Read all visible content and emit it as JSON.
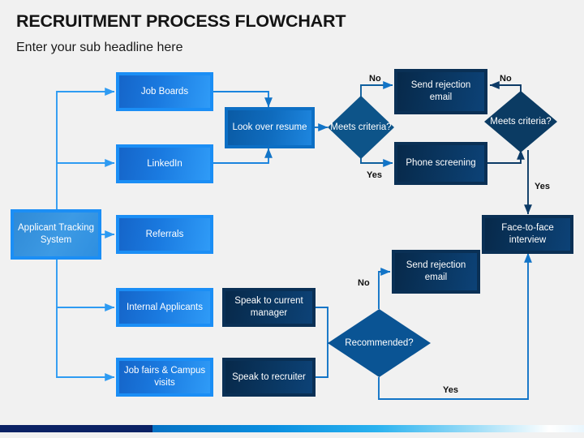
{
  "slide": {
    "title": "RECRUITMENT PROCESS FLOWCHART",
    "subtitle": "Enter your sub headline here",
    "background_color": "#f1f1f1",
    "accent_bright": "#1b8ef5",
    "accent_navy": "#0a3055",
    "accent_mid": "#0d6fc4",
    "bar_navy_color": "#0b2265",
    "bar_blue_color": "#0a8fe0"
  },
  "nodes": {
    "ats": "Applicant Tracking System",
    "job_boards": "Job Boards",
    "linkedin": "LinkedIn",
    "referrals": "Referrals",
    "internal_applicants": "Internal Applicants",
    "job_fairs": "Job fairs & Campus visits",
    "speak_manager": "Speak to current manager",
    "speak_recruiter": "Speak to recruiter",
    "look_over_resume": "Look over resume",
    "meets_criteria_1": "Meets criteria?",
    "meets_criteria_2": "Meets criteria?",
    "send_rejection_1": "Send rejection email",
    "send_rejection_2": "Send rejection email",
    "phone_screening": "Phone screening",
    "face_to_face": "Face-to-face interview",
    "recommended": "Recommended?"
  },
  "edge_labels": {
    "no_1": "No",
    "yes_1": "Yes",
    "no_2": "No",
    "yes_2": "Yes",
    "no_3": "No",
    "yes_3": "Yes"
  }
}
